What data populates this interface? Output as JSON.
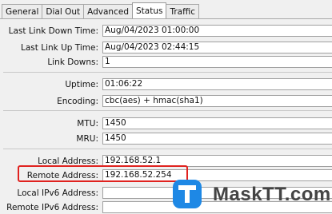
{
  "tabs": [
    {
      "label": "General"
    },
    {
      "label": "Dial Out"
    },
    {
      "label": "Advanced"
    },
    {
      "label": "Status"
    },
    {
      "label": "Traffic"
    }
  ],
  "active_tab": "Status",
  "status": {
    "last_link_down_time": {
      "label": "Last Link Down Time:",
      "value": "Aug/04/2023 01:00:00"
    },
    "last_link_up_time": {
      "label": "Last Link Up Time:",
      "value": "Aug/04/2023 02:44:15"
    },
    "link_downs": {
      "label": "Link Downs:",
      "value": "1"
    },
    "uptime": {
      "label": "Uptime:",
      "value": "01:06:22"
    },
    "encoding": {
      "label": "Encoding:",
      "value": "cbc(aes) + hmac(sha1)"
    },
    "mtu": {
      "label": "MTU:",
      "value": "1450"
    },
    "mru": {
      "label": "MRU:",
      "value": "1450"
    },
    "local_address": {
      "label": "Local Address:",
      "value": "192.168.52.1"
    },
    "remote_address": {
      "label": "Remote Address:",
      "value": "192.168.52.254"
    },
    "local_ipv6_address": {
      "label": "Local IPv6 Address:",
      "value": ""
    },
    "remote_ipv6_address": {
      "label": "Remote IPv6 Address:",
      "value": ""
    }
  },
  "highlight_color": "#e0221f",
  "watermark": {
    "text": "MaskTT.com",
    "badge_letter": "T",
    "badge_color": "#1e88e5"
  }
}
